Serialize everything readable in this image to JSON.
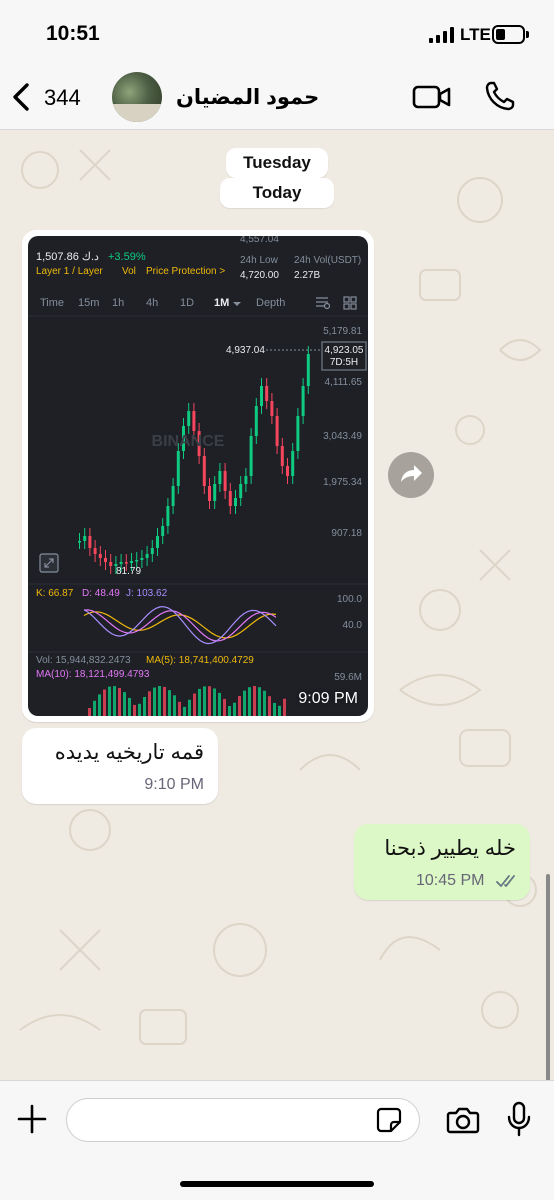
{
  "status_bar": {
    "time": "10:51",
    "network": "LTE",
    "battery_level": 0.28
  },
  "header": {
    "back_count": "344",
    "contact_name": "حمود المضيان",
    "icons": [
      "chevron-left-icon",
      "video-call-icon",
      "phone-icon"
    ]
  },
  "chat": {
    "date_labels": [
      "Tuesday",
      "Today"
    ],
    "image_message": {
      "time": "9:09 PM",
      "screenshot": {
        "price_line": "1,507.86 د.ك",
        "change": "+3.59%",
        "tags": [
          "Layer 1 / Layer",
          "Vol",
          "Price Protection >"
        ],
        "low_label": "24h Low",
        "low_value": "4,720.00",
        "vol_label": "24h Vol(USDT)",
        "vol_value": "2.27B",
        "top_value": "4,557.04",
        "timeframes": [
          "Time",
          "15m",
          "1h",
          "4h",
          "1D",
          "1M",
          "Depth"
        ],
        "active_timeframe": "1M",
        "y_ticks": [
          "5,179.81",
          "4,111.65",
          "3,043.49",
          "1,975.34",
          "907.18"
        ],
        "high_marker": "4,937.04",
        "current_price": "4,923.05",
        "countdown": "7D:5H",
        "low_marker": "81.79",
        "watermark": "BINANCE",
        "kdj": {
          "k": "K: 66.87",
          "d": "D: 48.49",
          "j": "J: 103.62"
        },
        "kdj_ticks": [
          "100.0",
          "40.0"
        ],
        "vol_line": "Vol: 15,944,832.2473",
        "ma5": "MA(5): 18,741,400.4729",
        "ma10": "MA(10): 18,121,499.4793",
        "vol_tick": "59.6M"
      }
    },
    "incoming": {
      "text": "قمه تاريخيه يديده",
      "time": "9:10 PM"
    },
    "outgoing": {
      "text": "خله يطيير ذبحنا",
      "time": "10:45 PM",
      "status": "read"
    }
  },
  "input": {
    "placeholder": ""
  },
  "colors": {
    "chat_bg": "#efeae2",
    "outgoing_bubble": "#dcf8c6",
    "incoming_bubble": "#ffffff",
    "read_ticks": "#667781",
    "bull": "#0ecb81",
    "bear": "#f6465d",
    "binance_yellow": "#f0b90b"
  }
}
